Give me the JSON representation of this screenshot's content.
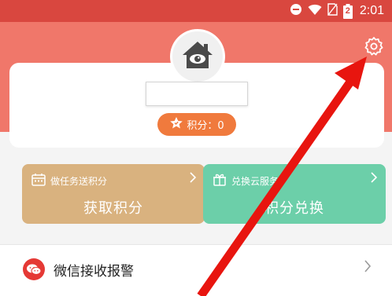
{
  "status_bar": {
    "time": "2:01",
    "battery_level": "2"
  },
  "profile": {
    "points_label": "积分：0"
  },
  "actions": [
    {
      "subtitle": "做任务送积分",
      "title": "获取积分",
      "color": "#d9b27f"
    },
    {
      "subtitle": "兑换云服务",
      "title": "积分兑换",
      "color": "#6ccfa9"
    }
  ],
  "list_items": [
    {
      "label": "微信接收报警"
    }
  ],
  "colors": {
    "header": "#f0776a",
    "status_bar": "#d9473f",
    "points_badge": "#f07a3d",
    "annotation_arrow": "#e8150f"
  }
}
